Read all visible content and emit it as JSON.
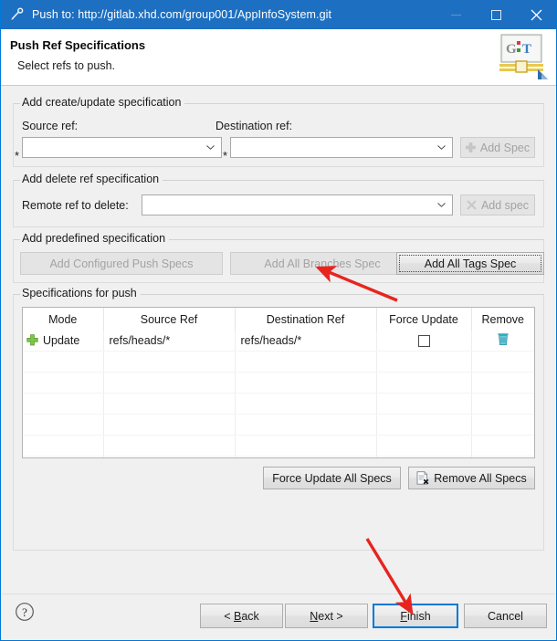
{
  "window": {
    "title": "Push to: http://gitlab.xhd.com/group001/AppInfoSystem.git",
    "icon": "push-branch-icon",
    "minimize_label": "Minimize",
    "maximize_label": "Maximize",
    "close_label": "Close",
    "accent_color": "#1d6fc1"
  },
  "header": {
    "title": "Push Ref Specifications",
    "subtitle": "Select refs to push.",
    "logo": "git-logo"
  },
  "create_update_group": {
    "legend": "Add create/update specification",
    "source_label": "Source ref:",
    "source_value": "",
    "source_required_marker": "*",
    "destination_label": "Destination ref:",
    "destination_value": "",
    "destination_required_marker": "*",
    "add_spec_label": "Add Spec",
    "add_spec_icon": "plus-icon",
    "add_spec_enabled": false
  },
  "delete_group": {
    "legend": "Add delete ref specification",
    "remote_label": "Remote ref to delete:",
    "remote_value": "",
    "add_spec_label": "Add spec",
    "add_spec_icon": "x-icon",
    "add_spec_enabled": false
  },
  "predefined_group": {
    "legend": "Add predefined specification",
    "buttons": [
      {
        "label": "Add Configured Push Specs",
        "enabled": false
      },
      {
        "label": "Add All Branches Spec",
        "enabled": false
      },
      {
        "label": "Add All Tags Spec",
        "enabled": true,
        "focused": true
      }
    ]
  },
  "specs_group": {
    "legend": "Specifications for push",
    "columns": [
      "Mode",
      "Source Ref",
      "Destination Ref",
      "Force Update",
      "Remove"
    ],
    "rows": [
      {
        "mode_icon": "green-plus-icon",
        "mode": "Update",
        "source_ref": "refs/heads/*",
        "destination_ref": "refs/heads/*",
        "force_update_checked": false,
        "remove_icon": "trash-icon"
      }
    ],
    "empty_row_count": 6,
    "force_update_all_label": "Force Update All Specs",
    "remove_all_label": "Remove All Specs",
    "remove_all_icon": "remove-all-icon"
  },
  "footer": {
    "help_icon": "help-icon",
    "buttons": [
      {
        "label": "< Back",
        "name": "back-button",
        "default": false
      },
      {
        "label": "Next >",
        "name": "next-button",
        "default": false
      },
      {
        "label": "Finish",
        "name": "finish-button",
        "default": true
      },
      {
        "label": "Cancel",
        "name": "cancel-button",
        "default": false
      }
    ]
  },
  "annotations": {
    "arrow_color": "#e8241f",
    "arrow1_target": "Add All Branches Spec",
    "arrow2_target": "Finish"
  }
}
